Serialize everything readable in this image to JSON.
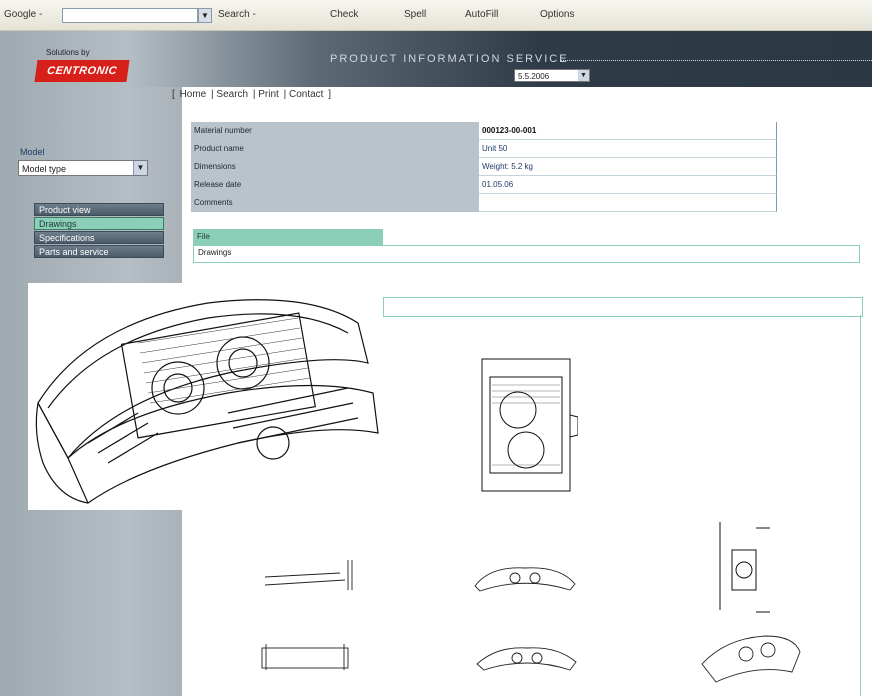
{
  "toolbar": {
    "google_label": "Google -",
    "items": [
      "Search -",
      "Check",
      "Spell",
      "AutoFill",
      "Options"
    ]
  },
  "sidebar": {
    "logo_caption": "Solutions by",
    "logo_text": "CENTRONIC",
    "model_label": "Model",
    "model_value": "Model type",
    "nav": [
      {
        "label": "Product view"
      },
      {
        "label": "Drawings"
      },
      {
        "label": "Specifications"
      },
      {
        "label": "Parts and service"
      }
    ]
  },
  "header": {
    "banner_title": "PRODUCT INFORMATION SERVICE",
    "date_value": "5.5.2006"
  },
  "topnav": {
    "items": [
      "Home",
      "Search",
      "Print",
      "Contact"
    ]
  },
  "info": {
    "rows": [
      {
        "key": "Material number",
        "value": "000123-00-001"
      },
      {
        "key": "Product name",
        "value": "Unit 50"
      },
      {
        "key": "Dimensions",
        "value": "Weight: 5.2 kg"
      },
      {
        "key": "Release date",
        "value": "01.05.06"
      },
      {
        "key": "Comments",
        "value": ""
      }
    ]
  },
  "section": {
    "tab_label": "File",
    "content": "Drawings"
  },
  "colors": {
    "accent": "#8bcfb8",
    "logo_red": "#d8201a",
    "banner_dark": "#2f3c48"
  }
}
